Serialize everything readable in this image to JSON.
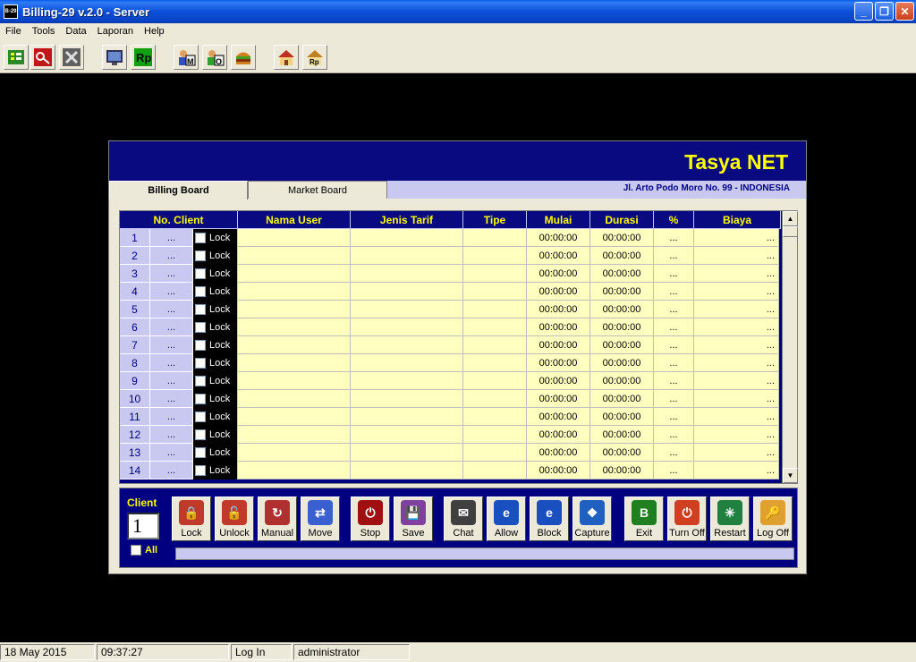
{
  "window": {
    "title": "Billing-29 v.2.0 - Server",
    "app_icon_text": "B-29",
    "minimize": "_",
    "maximize": "❐",
    "close": "✕"
  },
  "menu": [
    "File",
    "Tools",
    "Data",
    "Laporan",
    "Help"
  ],
  "toolbar_icons": [
    "client-list-icon",
    "key-icon",
    "close-x-icon",
    "monitor-icon",
    "rp-money-icon",
    "member-icon",
    "operator-icon",
    "burger-icon",
    "house-icon",
    "house-rp-icon"
  ],
  "brand": "Tasya NET",
  "tabs": {
    "billing": "Billing Board",
    "market": "Market Board"
  },
  "address": "Jl. Arto Podo Moro No. 99 - INDONESIA",
  "grid": {
    "headers": [
      "No. Client",
      "Nama User",
      "Jenis Tarif",
      "Tipe",
      "Mulai",
      "Durasi",
      "%",
      "Biaya"
    ],
    "lock_label": "Lock",
    "dots": "...",
    "rows": [
      {
        "no": "1",
        "mulai": "00:00:00",
        "durasi": "00:00:00"
      },
      {
        "no": "2",
        "mulai": "00:00:00",
        "durasi": "00:00:00"
      },
      {
        "no": "3",
        "mulai": "00:00:00",
        "durasi": "00:00:00"
      },
      {
        "no": "4",
        "mulai": "00:00:00",
        "durasi": "00:00:00"
      },
      {
        "no": "5",
        "mulai": "00:00:00",
        "durasi": "00:00:00"
      },
      {
        "no": "6",
        "mulai": "00:00:00",
        "durasi": "00:00:00"
      },
      {
        "no": "7",
        "mulai": "00:00:00",
        "durasi": "00:00:00"
      },
      {
        "no": "8",
        "mulai": "00:00:00",
        "durasi": "00:00:00"
      },
      {
        "no": "9",
        "mulai": "00:00:00",
        "durasi": "00:00:00"
      },
      {
        "no": "10",
        "mulai": "00:00:00",
        "durasi": "00:00:00"
      },
      {
        "no": "11",
        "mulai": "00:00:00",
        "durasi": "00:00:00"
      },
      {
        "no": "12",
        "mulai": "00:00:00",
        "durasi": "00:00:00"
      },
      {
        "no": "13",
        "mulai": "00:00:00",
        "durasi": "00:00:00"
      },
      {
        "no": "14",
        "mulai": "00:00:00",
        "durasi": "00:00:00"
      }
    ]
  },
  "panel": {
    "client_label": "Client",
    "client_value": "1",
    "all_label": "All",
    "actions": [
      {
        "label": "Lock",
        "icon": "lock-icon",
        "color": "#c0392b"
      },
      {
        "label": "Unlock",
        "icon": "unlock-icon",
        "color": "#c0392b"
      },
      {
        "label": "Manual",
        "icon": "manual-icon",
        "color": "#b03030"
      },
      {
        "label": "Move",
        "icon": "move-icon",
        "color": "#3a5fd0"
      },
      {
        "label": "Stop",
        "icon": "stop-icon",
        "color": "#a01010"
      },
      {
        "label": "Save",
        "icon": "save-icon",
        "color": "#8040a0"
      },
      {
        "label": "Chat",
        "icon": "chat-icon",
        "color": "#404040"
      },
      {
        "label": "Allow",
        "icon": "allow-icon",
        "color": "#1a4fc0"
      },
      {
        "label": "Block",
        "icon": "block-icon",
        "color": "#1a4fc0"
      },
      {
        "label": "Capture",
        "icon": "capture-icon",
        "color": "#2060c0"
      },
      {
        "label": "Exit",
        "icon": "exit-icon",
        "color": "#208020"
      },
      {
        "label": "Turn Off",
        "icon": "power-icon",
        "color": "#d04020"
      },
      {
        "label": "Restart",
        "icon": "restart-icon",
        "color": "#208040"
      },
      {
        "label": "Log Off",
        "icon": "logoff-icon",
        "color": "#e0a030"
      }
    ]
  },
  "status": {
    "date": "18 May 2015",
    "time": "09:37:27",
    "state": "Log In",
    "user": "administrator"
  }
}
